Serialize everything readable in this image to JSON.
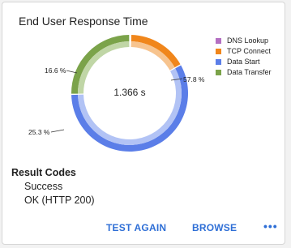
{
  "card": {
    "title": "End User Response Time",
    "center_value": "1.366 s"
  },
  "chart_data": {
    "type": "pie",
    "categories": [
      "DNS Lookup",
      "TCP Connect",
      "Data Start",
      "Data Transfer"
    ],
    "values": [
      0.3,
      16.6,
      57.8,
      25.3
    ],
    "value_labels": [
      "",
      "16.6 %",
      "57.8 %",
      "25.3 %"
    ],
    "colors": [
      "#b46fc2",
      "#f0861b",
      "#5b7ee8",
      "#7ba34a"
    ],
    "light_colors": [
      "#d7b3df",
      "#f7c48f",
      "#b2c3f5",
      "#c0d6a6"
    ],
    "legend_position": "right"
  },
  "result_codes": {
    "heading": "Result Codes",
    "lines": [
      "Success",
      "OK (HTTP 200)"
    ]
  },
  "actions": {
    "test_again": "TEST AGAIN",
    "browse": "BROWSE",
    "more": "•••"
  }
}
